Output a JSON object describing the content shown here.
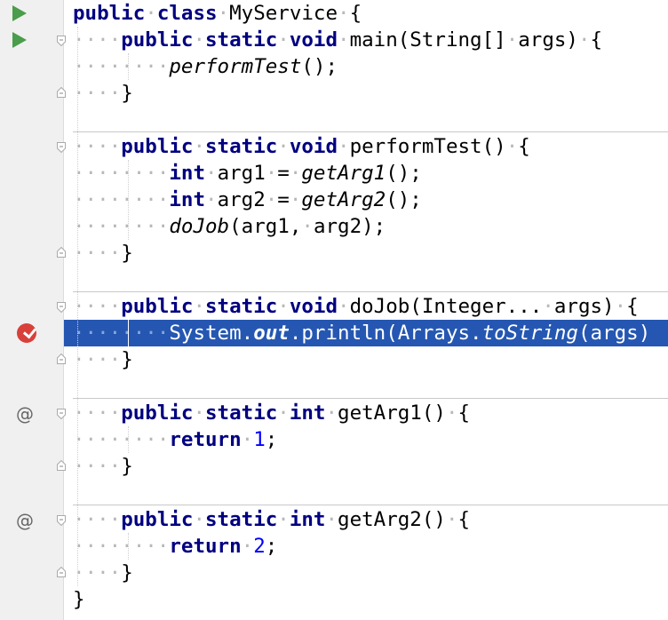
{
  "editor": {
    "dot": "·",
    "breakpoint_line": 12,
    "lines": [
      {
        "tokens": [
          {
            "t": "public",
            "c": "kw"
          },
          {
            "t": "·",
            "c": "ws"
          },
          {
            "t": "class",
            "c": "kw"
          },
          {
            "t": "·",
            "c": "ws"
          },
          {
            "t": "MyService",
            "c": ""
          },
          {
            "t": "·",
            "c": "ws"
          },
          {
            "t": "{",
            "c": ""
          }
        ]
      },
      {
        "tokens": [
          {
            "t": "····",
            "c": "ws"
          },
          {
            "t": "public",
            "c": "kw"
          },
          {
            "t": "·",
            "c": "ws"
          },
          {
            "t": "static",
            "c": "kw"
          },
          {
            "t": "·",
            "c": "ws"
          },
          {
            "t": "void",
            "c": "kw"
          },
          {
            "t": "·",
            "c": "ws"
          },
          {
            "t": "main(String[]",
            "c": ""
          },
          {
            "t": "·",
            "c": "ws"
          },
          {
            "t": "args)",
            "c": ""
          },
          {
            "t": "·",
            "c": "ws"
          },
          {
            "t": "{",
            "c": ""
          }
        ]
      },
      {
        "tokens": [
          {
            "t": "········",
            "c": "ws"
          },
          {
            "t": "performTest",
            "c": "it"
          },
          {
            "t": "();",
            "c": ""
          }
        ]
      },
      {
        "tokens": [
          {
            "t": "····",
            "c": "ws"
          },
          {
            "t": "}",
            "c": ""
          }
        ]
      },
      {
        "tokens": []
      },
      {
        "tokens": [
          {
            "t": "····",
            "c": "ws"
          },
          {
            "t": "public",
            "c": "kw"
          },
          {
            "t": "·",
            "c": "ws"
          },
          {
            "t": "static",
            "c": "kw"
          },
          {
            "t": "·",
            "c": "ws"
          },
          {
            "t": "void",
            "c": "kw"
          },
          {
            "t": "·",
            "c": "ws"
          },
          {
            "t": "performTest()",
            "c": ""
          },
          {
            "t": "·",
            "c": "ws"
          },
          {
            "t": "{",
            "c": ""
          }
        ]
      },
      {
        "tokens": [
          {
            "t": "········",
            "c": "ws"
          },
          {
            "t": "int",
            "c": "kw"
          },
          {
            "t": "·",
            "c": "ws"
          },
          {
            "t": "arg1",
            "c": ""
          },
          {
            "t": "·",
            "c": "ws"
          },
          {
            "t": "=",
            "c": ""
          },
          {
            "t": "·",
            "c": "ws"
          },
          {
            "t": "getArg1",
            "c": "it"
          },
          {
            "t": "();",
            "c": ""
          }
        ]
      },
      {
        "tokens": [
          {
            "t": "········",
            "c": "ws"
          },
          {
            "t": "int",
            "c": "kw"
          },
          {
            "t": "·",
            "c": "ws"
          },
          {
            "t": "arg2",
            "c": ""
          },
          {
            "t": "·",
            "c": "ws"
          },
          {
            "t": "=",
            "c": ""
          },
          {
            "t": "·",
            "c": "ws"
          },
          {
            "t": "getArg2",
            "c": "it"
          },
          {
            "t": "();",
            "c": ""
          }
        ]
      },
      {
        "tokens": [
          {
            "t": "········",
            "c": "ws"
          },
          {
            "t": "doJob",
            "c": "it"
          },
          {
            "t": "(arg1,",
            "c": ""
          },
          {
            "t": "·",
            "c": "ws"
          },
          {
            "t": "arg2);",
            "c": ""
          }
        ]
      },
      {
        "tokens": [
          {
            "t": "····",
            "c": "ws"
          },
          {
            "t": "}",
            "c": ""
          }
        ]
      },
      {
        "tokens": []
      },
      {
        "tokens": [
          {
            "t": "····",
            "c": "ws"
          },
          {
            "t": "public",
            "c": "kw"
          },
          {
            "t": "·",
            "c": "ws"
          },
          {
            "t": "static",
            "c": "kw"
          },
          {
            "t": "·",
            "c": "ws"
          },
          {
            "t": "void",
            "c": "kw"
          },
          {
            "t": "·",
            "c": "ws"
          },
          {
            "t": "doJob(Integer...",
            "c": ""
          },
          {
            "t": "·",
            "c": "ws"
          },
          {
            "t": "args)",
            "c": ""
          },
          {
            "t": "·",
            "c": "ws"
          },
          {
            "t": "{",
            "c": ""
          }
        ]
      },
      {
        "tokens": [
          {
            "t": "········",
            "c": "ws"
          },
          {
            "t": "System.",
            "c": ""
          },
          {
            "t": "out",
            "c": "fld"
          },
          {
            "t": ".println(Arrays.",
            "c": ""
          },
          {
            "t": "toString",
            "c": "it"
          },
          {
            "t": "(args)",
            "c": ""
          }
        ]
      },
      {
        "tokens": [
          {
            "t": "····",
            "c": "ws"
          },
          {
            "t": "}",
            "c": ""
          }
        ]
      },
      {
        "tokens": []
      },
      {
        "tokens": [
          {
            "t": "····",
            "c": "ws"
          },
          {
            "t": "public",
            "c": "kw"
          },
          {
            "t": "·",
            "c": "ws"
          },
          {
            "t": "static",
            "c": "kw"
          },
          {
            "t": "·",
            "c": "ws"
          },
          {
            "t": "int",
            "c": "kw"
          },
          {
            "t": "·",
            "c": "ws"
          },
          {
            "t": "getArg1()",
            "c": ""
          },
          {
            "t": "·",
            "c": "ws"
          },
          {
            "t": "{",
            "c": ""
          }
        ]
      },
      {
        "tokens": [
          {
            "t": "········",
            "c": "ws"
          },
          {
            "t": "return",
            "c": "kw"
          },
          {
            "t": "·",
            "c": "ws"
          },
          {
            "t": "1",
            "c": "num"
          },
          {
            "t": ";",
            "c": ""
          }
        ]
      },
      {
        "tokens": [
          {
            "t": "····",
            "c": "ws"
          },
          {
            "t": "}",
            "c": ""
          }
        ]
      },
      {
        "tokens": []
      },
      {
        "tokens": [
          {
            "t": "····",
            "c": "ws"
          },
          {
            "t": "public",
            "c": "kw"
          },
          {
            "t": "·",
            "c": "ws"
          },
          {
            "t": "static",
            "c": "kw"
          },
          {
            "t": "·",
            "c": "ws"
          },
          {
            "t": "int",
            "c": "kw"
          },
          {
            "t": "·",
            "c": "ws"
          },
          {
            "t": "getArg2()",
            "c": ""
          },
          {
            "t": "·",
            "c": "ws"
          },
          {
            "t": "{",
            "c": ""
          }
        ]
      },
      {
        "tokens": [
          {
            "t": "········",
            "c": "ws"
          },
          {
            "t": "return",
            "c": "kw"
          },
          {
            "t": "·",
            "c": "ws"
          },
          {
            "t": "2",
            "c": "num"
          },
          {
            "t": ";",
            "c": ""
          }
        ]
      },
      {
        "tokens": [
          {
            "t": "····",
            "c": "ws"
          },
          {
            "t": "}",
            "c": ""
          }
        ]
      },
      {
        "tokens": [
          {
            "t": "}",
            "c": ""
          }
        ]
      }
    ],
    "gutter": {
      "run_icons": [
        "run-class-icon",
        "run-main-icon"
      ],
      "breakpoint_icon": "verified-breakpoint-icon",
      "override_icon_glyph": "@",
      "override_icons": [
        "implements-method-icon",
        "implements-method-icon"
      ]
    },
    "colors": {
      "keyword": "#000080",
      "number": "#0000ff",
      "selection": "#2557b2",
      "run": "#4a9d4a",
      "breakpoint": "#d8403a",
      "gutter": "#f0f0f0"
    }
  }
}
